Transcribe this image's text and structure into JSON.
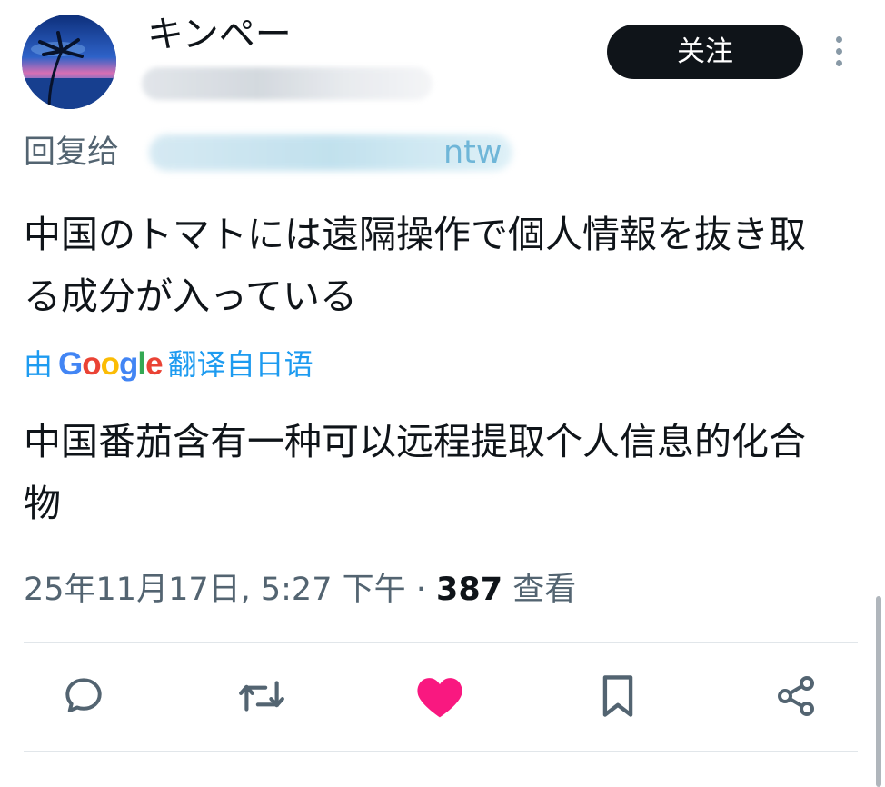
{
  "user": {
    "display_name": "キンペー",
    "follow_label": "关注"
  },
  "reply_to": {
    "prefix": "回复给",
    "handle_tail": "ntw"
  },
  "tweet": {
    "text": "中国のトマトには遠隔操作で個人情報を抜き取る成分が入っている",
    "translation_prefix": "由",
    "translation_brand": "Google",
    "translation_suffix": "翻译自日语",
    "translated_text": "中国番茄含有一种可以远程提取个人信息的化合物",
    "timestamp": "25年11月17日, 5:27 下午",
    "separator": "·",
    "views_count": "387",
    "views_label": "查看"
  },
  "actions": {
    "reply_icon": "speech-bubble-icon",
    "retweet_icon": "retweet-icon",
    "like_icon": "heart-icon",
    "like_color": "#f91880",
    "bookmark_icon": "bookmark-icon",
    "share_icon": "share-icon"
  }
}
